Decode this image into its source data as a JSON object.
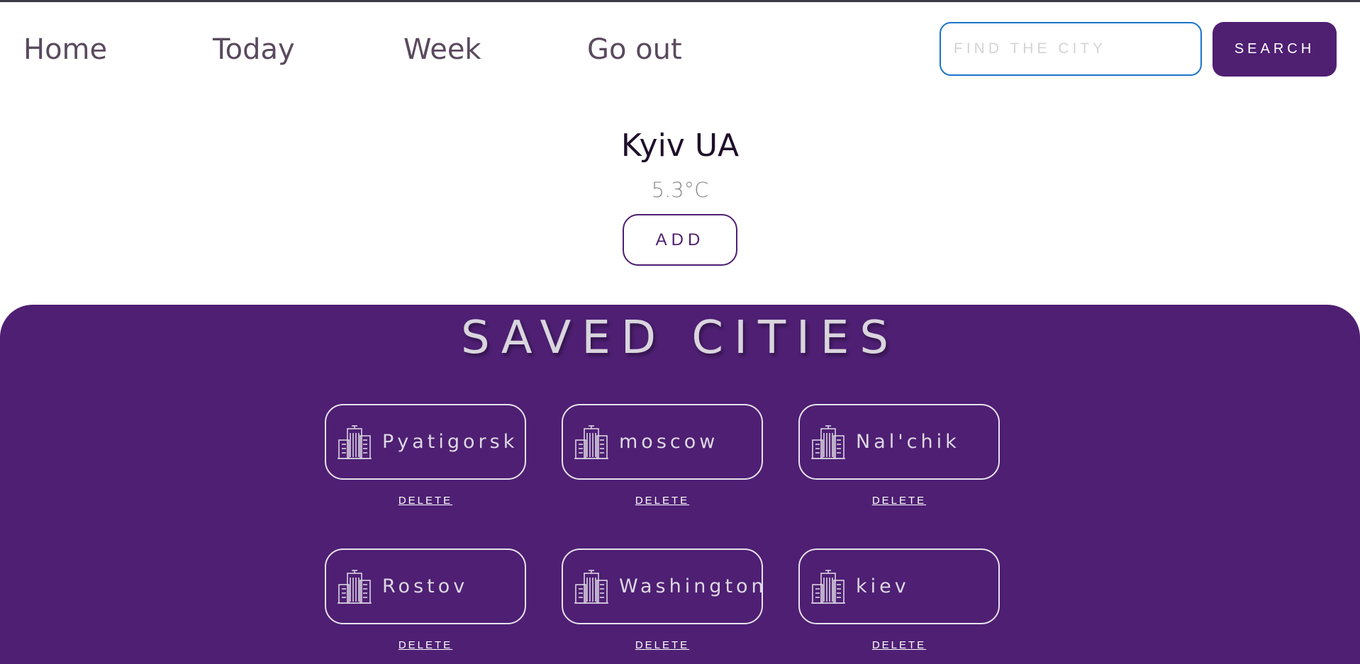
{
  "nav": {
    "items": [
      "Home",
      "Today",
      "Week",
      "Go out"
    ]
  },
  "search": {
    "placeholder": "FIND THE CITY",
    "button_label": "SEARCH"
  },
  "current": {
    "city": "Kyiv UA",
    "temperature": "5.3°C",
    "add_label": "ADD"
  },
  "saved": {
    "title": "SAVED CITIES",
    "delete_label": "DELETE",
    "cities": [
      "Pyatigorsk",
      "moscow",
      "Nal'chik",
      "Rostov",
      "Washington",
      "kiev"
    ],
    "icon": "city-buildings-icon"
  },
  "colors": {
    "brand_purple": "#4e1f73",
    "search_border": "#1a74c9"
  }
}
